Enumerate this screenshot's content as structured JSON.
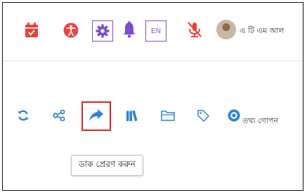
{
  "colors": {
    "calendar": "#e8413b",
    "accessibility": "#ee4444",
    "accent_purple": "#7b4fcf",
    "mic_off": "#e8413b",
    "toolbar_blue": "#2a84d6",
    "books": "#2a84d6",
    "highlight_border": "#e02020"
  },
  "header": {
    "icons": [
      "calendar-check-icon",
      "accessibility-icon",
      "gear-icon",
      "bell-icon",
      "mic-off-icon"
    ],
    "language_label": "EN",
    "user_name": "এ টি এম আল"
  },
  "toolbar": {
    "icons": [
      "refresh-icon",
      "share-icon",
      "forward-icon",
      "books-icon",
      "folder-icon",
      "tag-icon",
      "eye-icon"
    ],
    "hide_label": "তথ্য গোপন"
  },
  "tooltip": {
    "text": "ডাক প্রেরণ করুন"
  }
}
